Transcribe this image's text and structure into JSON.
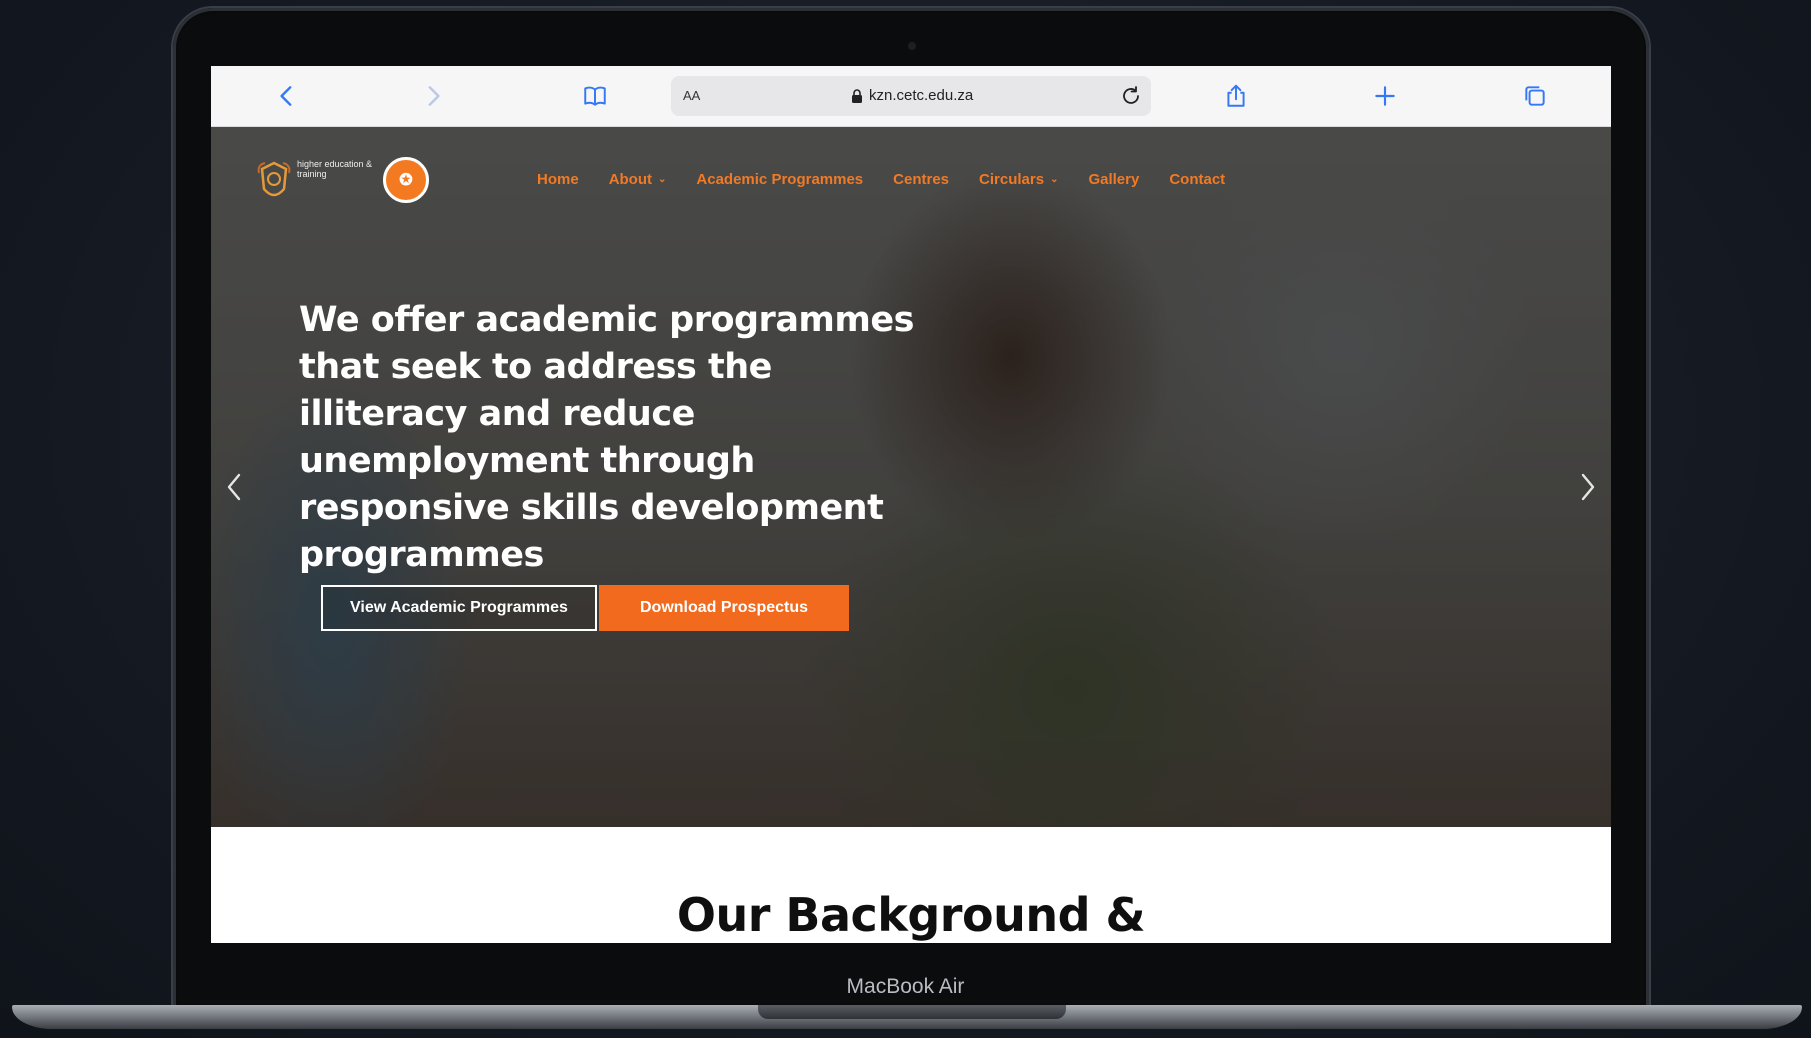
{
  "browser": {
    "address_aa": "AA",
    "url": "kzn.cetc.edu.za"
  },
  "site": {
    "logo_text": "higher education & training",
    "nav": [
      {
        "label": "Home"
      },
      {
        "label": "About",
        "dropdown": true
      },
      {
        "label": "Academic Programmes"
      },
      {
        "label": "Centres"
      },
      {
        "label": "Circulars",
        "dropdown": true
      },
      {
        "label": "Gallery"
      },
      {
        "label": "Contact"
      }
    ],
    "hero": {
      "headline": "We offer academic programmes that seek to address the illiteracy and reduce unemployment through responsive skills development programmes",
      "button_primary": "View Academic Programmes",
      "button_secondary": "Download Prospectus"
    },
    "section_title": "Our Background &"
  },
  "device": {
    "model": "MacBook Air"
  },
  "colors": {
    "accent": "#f26a1e",
    "nav_text": "#f07a26",
    "toolbar_icons": "#3478f6"
  },
  "icons": {
    "back": "chevron-left-icon",
    "forward": "chevron-right-icon",
    "bookmarks": "book-icon",
    "lock": "lock-icon",
    "reload": "reload-icon",
    "share": "share-icon",
    "new_tab": "plus-icon",
    "tabs": "tabs-icon"
  }
}
